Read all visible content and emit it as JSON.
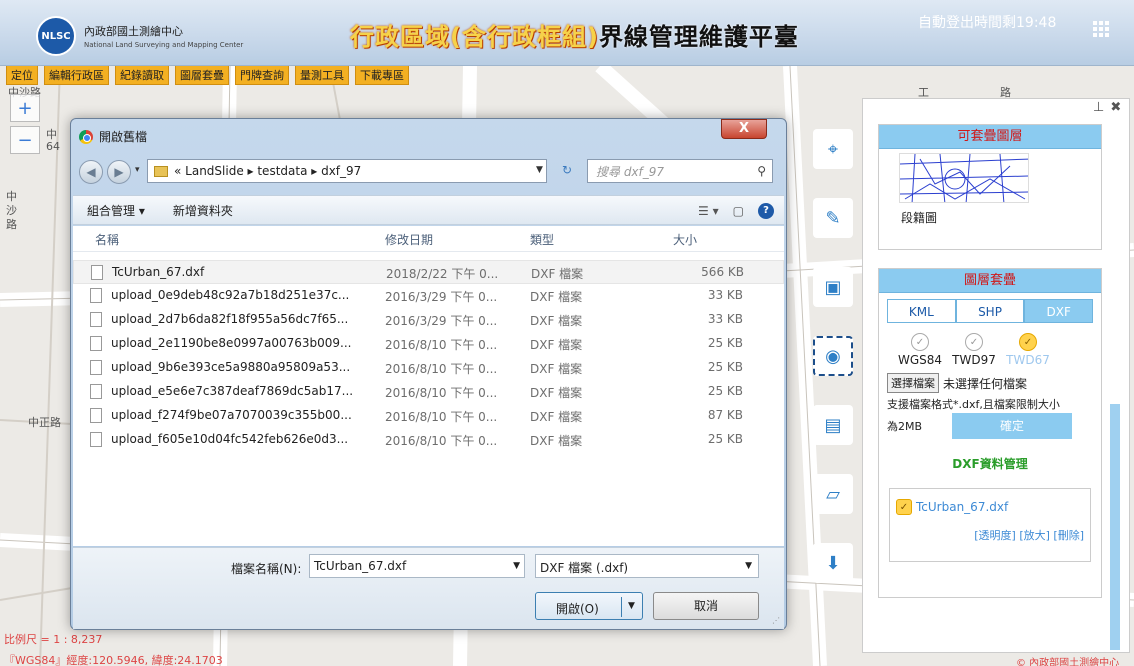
{
  "header": {
    "logo_abbr": "NLSC",
    "logo_cn": "內政部國土測繪中心",
    "logo_en": "National Land Surveying and Mapping Center",
    "title_highlight": "行政區域(含行政框組)",
    "title_main": "界線管理維護平臺",
    "logout_timer": "自動登出時間剩19:48"
  },
  "toolbar": [
    "定位",
    "編輯行政區",
    "紀錄讀取",
    "圖層套疊",
    "門牌查詢",
    "量測工具",
    "下載專區"
  ],
  "map": {
    "labels": [
      "中沙路",
      "中",
      "64",
      "中",
      "沙",
      "路",
      "中正路",
      "工",
      "路"
    ],
    "scale": "比例尺 = 1 : 8,237",
    "coords": "『WGS84』經度:120.5946, 緯度:24.1703",
    "copyright": "© 內政部國土測繪中心"
  },
  "panel": {
    "overlay_title": "可套疊圖層",
    "overlay_layer": "段籍圖",
    "layer_title": "圖層套疊",
    "tabs": [
      "KML",
      "SHP",
      "DXF"
    ],
    "active_tab": "DXF",
    "datums": [
      "WGS84",
      "TWD97",
      "TWD67"
    ],
    "selected_datum": "TWD67",
    "choose_file": "選擇檔案",
    "no_file": "未選擇任何檔案",
    "file_note_1": "支援檔案格式*.dxf,且檔案限制大小",
    "file_note_2": "為2MB",
    "confirm": "確定",
    "dxf_manage": "DXF資料管理",
    "dxf_file": "TcUrban_67.dxf",
    "dxf_actions": "[透明度] [放大] [刪除]"
  },
  "dialog": {
    "title": "開啟舊檔",
    "breadcrumb": "« LandSlide ▸ testdata ▸ dxf_97",
    "search_placeholder": "搜尋 dxf_97",
    "organize": "組合管理 ▾",
    "new_folder": "新增資料夾",
    "columns": [
      "名稱",
      "修改日期",
      "類型",
      "大小"
    ],
    "files": [
      {
        "name": "TcUrban_67.dxf",
        "date": "2018/2/22 下午 0...",
        "type": "DXF 檔案",
        "size": "566 KB"
      },
      {
        "name": "upload_0e9deb48c92a7b18d251e37c...",
        "date": "2016/3/29 下午 0...",
        "type": "DXF 檔案",
        "size": "33 KB"
      },
      {
        "name": "upload_2d7b6da82f18f955a56dc7f65...",
        "date": "2016/3/29 下午 0...",
        "type": "DXF 檔案",
        "size": "33 KB"
      },
      {
        "name": "upload_2e1190be8e0997a00763b009...",
        "date": "2016/8/10 下午 0...",
        "type": "DXF 檔案",
        "size": "25 KB"
      },
      {
        "name": "upload_9b6e393ce5a9880a95809a53...",
        "date": "2016/8/10 下午 0...",
        "type": "DXF 檔案",
        "size": "25 KB"
      },
      {
        "name": "upload_e5e6e7c387deaf7869dc5ab17...",
        "date": "2016/8/10 下午 0...",
        "type": "DXF 檔案",
        "size": "25 KB"
      },
      {
        "name": "upload_f274f9be07a7070039c355b00...",
        "date": "2016/8/10 下午 0...",
        "type": "DXF 檔案",
        "size": "87 KB"
      },
      {
        "name": "upload_f605e10d04fc542feb626e0d3...",
        "date": "2016/8/10 下午 0...",
        "type": "DXF 檔案",
        "size": "25 KB"
      }
    ],
    "filename_label": "檔案名稱(N):",
    "filename_value": "TcUrban_67.dxf",
    "filetype_value": "DXF 檔案 (.dxf)",
    "open_label": "開啟(O)",
    "cancel_label": "取消"
  }
}
